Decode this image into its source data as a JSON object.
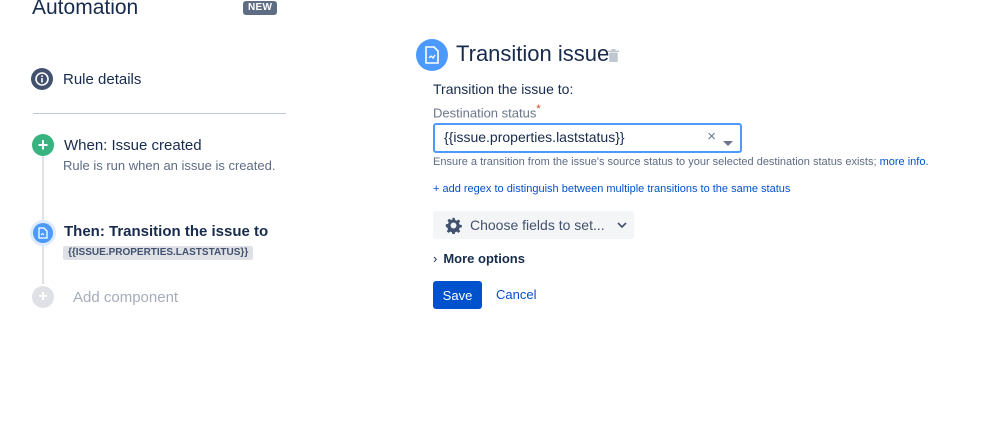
{
  "sidebar": {
    "title": "Automation",
    "badge": "NEW",
    "rule_details": "Rule details",
    "when_label": "When: Issue created",
    "when_desc": "Rule is run when an issue is created.",
    "then_label": "Then: Transition the issue to",
    "then_tag": "{{ISSUE.PROPERTIES.LASTSTATUS}}",
    "add_component": "Add component"
  },
  "main": {
    "title": "Transition issue",
    "transition_label": "Transition the issue to:",
    "destination_label": "Destination status",
    "required_mark": "*",
    "destination_value": "{{issue.properties.laststatus}}",
    "help_text": "Ensure a transition from the issue's source status to your selected destination status exists;",
    "help_link": "more info.",
    "regex_link": "+ add regex to distinguish between multiple transitions to the same status",
    "choose_fields": "Choose fields to set...",
    "more_options": "More options",
    "save": "Save",
    "cancel": "Cancel"
  },
  "colors": {
    "accent": "#0052cc",
    "when_green": "#36b37e",
    "then_blue": "#4c9aff"
  }
}
